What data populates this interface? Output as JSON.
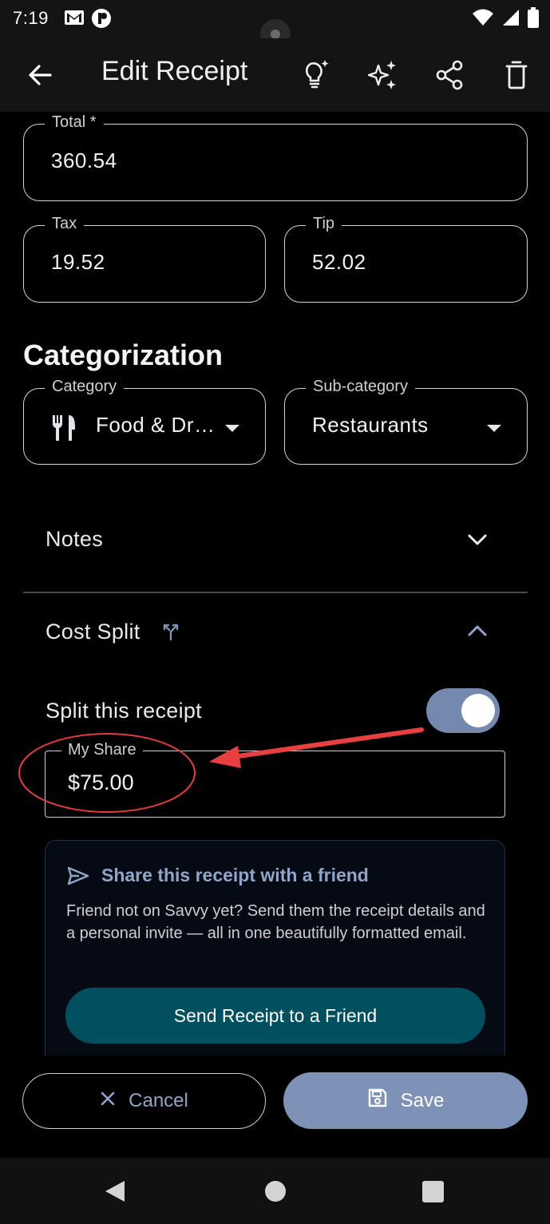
{
  "status_bar": {
    "time": "7:19",
    "left_icons": [
      "gmail-icon",
      "app-notification-icon"
    ],
    "right_icons": [
      "wifi-icon",
      "cell-signal-icon",
      "battery-icon"
    ]
  },
  "app_bar": {
    "title": "Edit Receipt",
    "actions": [
      "lightbulb-sparkle-icon",
      "sparkles-icon",
      "share-icon",
      "delete-icon"
    ]
  },
  "fields": {
    "total": {
      "label": "Total *",
      "value": "360.54"
    },
    "tax": {
      "label": "Tax",
      "value": "19.52"
    },
    "tip": {
      "label": "Tip",
      "value": "52.02"
    }
  },
  "categorization": {
    "heading": "Categorization",
    "category": {
      "label": "Category",
      "value": "Food & Dr…",
      "icon": "fork-knife-icon"
    },
    "subcategory": {
      "label": "Sub-category",
      "value": "Restaurants"
    }
  },
  "notes": {
    "label": "Notes"
  },
  "cost_split": {
    "label": "Cost Split",
    "split_toggle_label": "Split this receipt",
    "split_enabled": true,
    "my_share": {
      "label": "My Share",
      "value": "$75.00"
    }
  },
  "share_card": {
    "title": "Share this receipt with a friend",
    "body": "Friend not on Savvy yet? Send them the receipt details and a personal invite — all in one beautifully formatted email.",
    "button": "Send Receipt to a Friend"
  },
  "footer": {
    "cancel": "Cancel",
    "save": "Save"
  },
  "colors": {
    "accent": "#7d92b6",
    "teal_button": "#01505f",
    "annotation": "#e53b3b"
  }
}
